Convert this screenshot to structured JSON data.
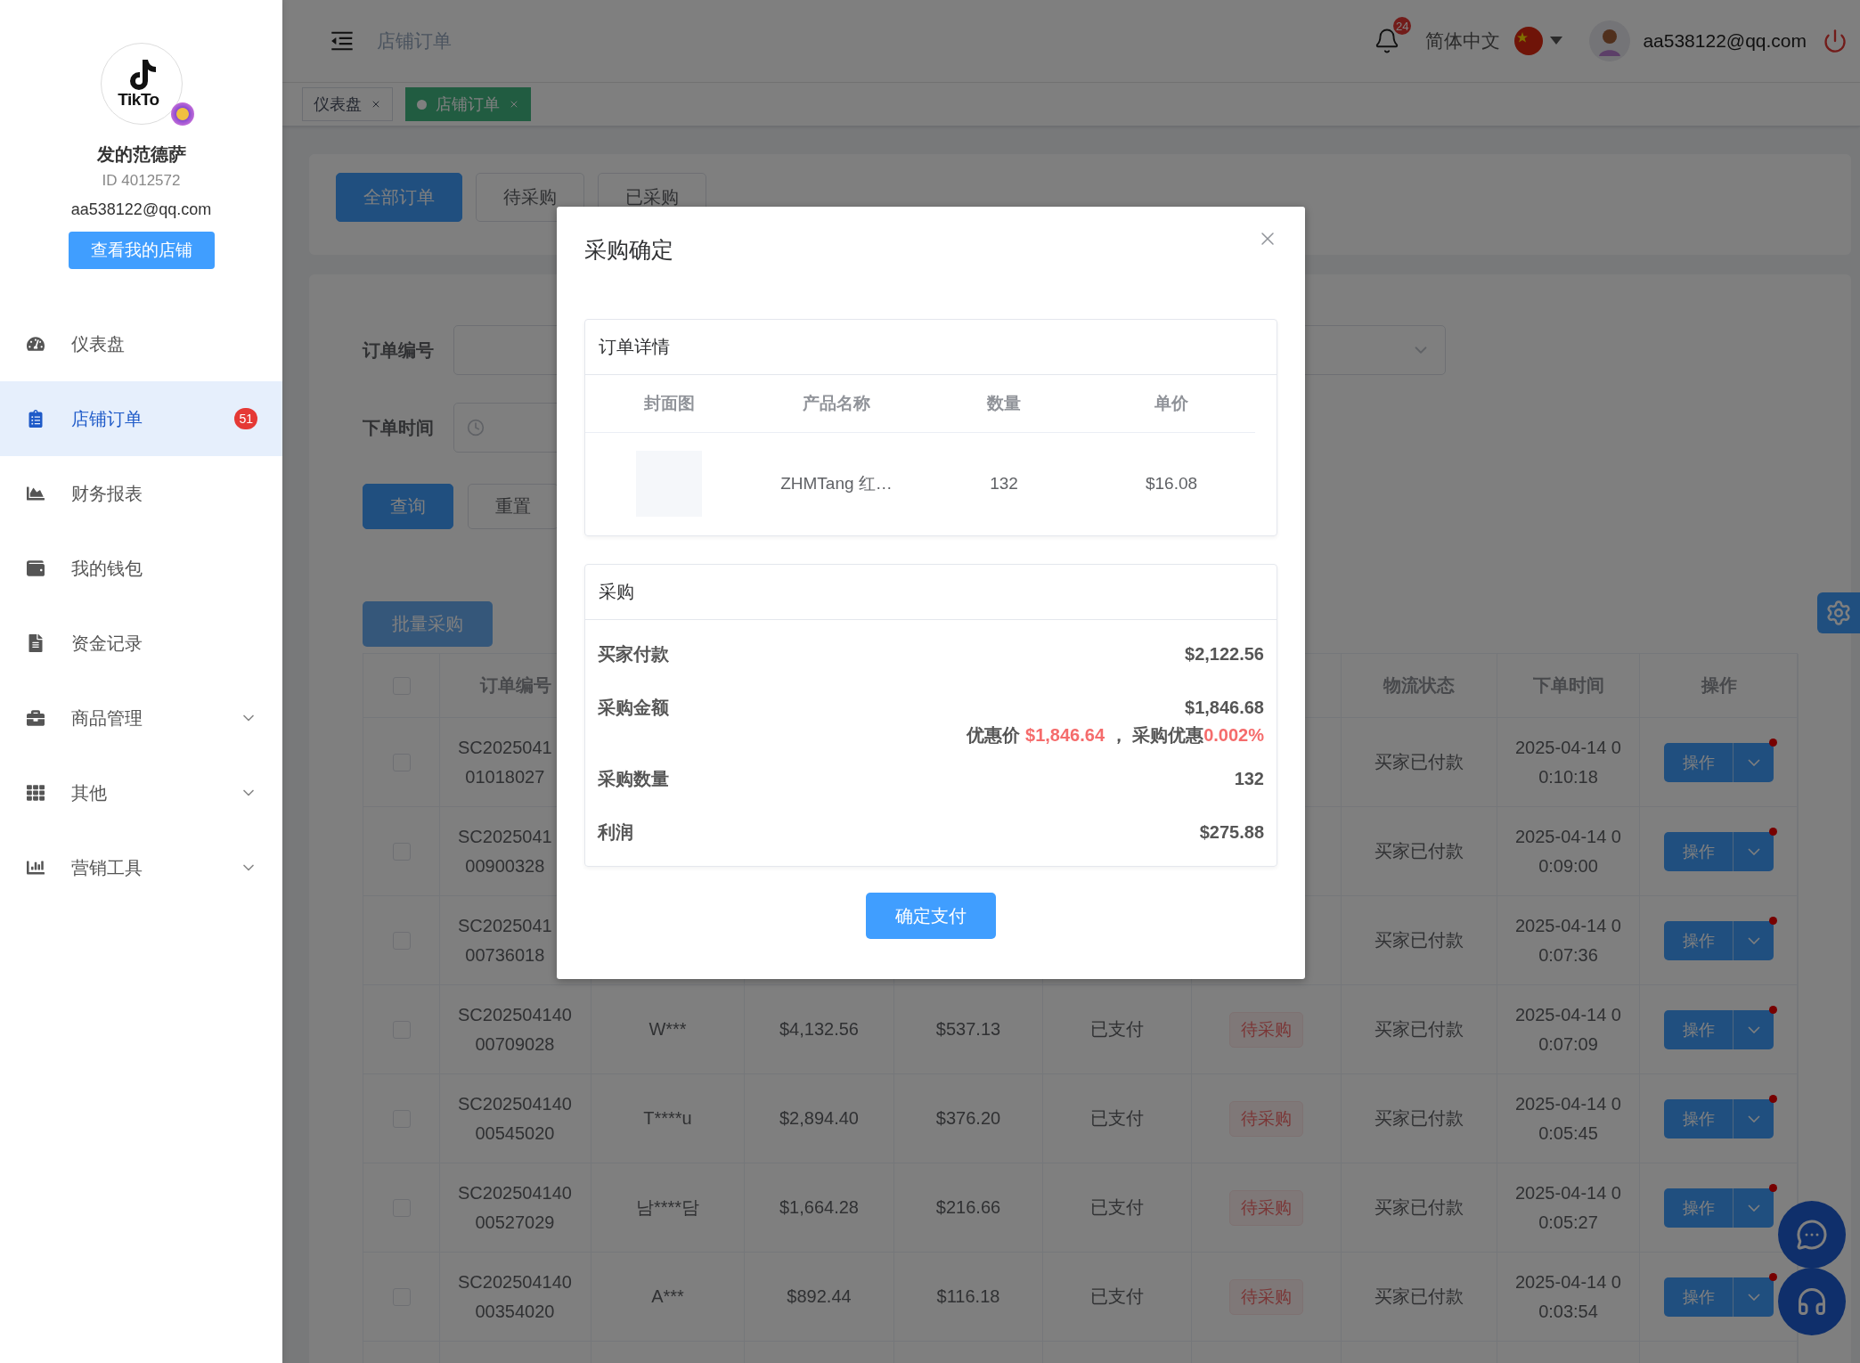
{
  "sidebar": {
    "logo_text": "TikTo",
    "shop_name": "发的范德萨",
    "shop_id": "ID 4012572",
    "email": "aa538122@qq.com",
    "shop_button": "查看我的店铺",
    "items": [
      {
        "label": "仪表盘",
        "selected": false
      },
      {
        "label": "店铺订单",
        "selected": true,
        "badge": "51"
      },
      {
        "label": "财务报表",
        "selected": false
      },
      {
        "label": "我的钱包",
        "selected": false
      },
      {
        "label": "资金记录",
        "selected": false
      },
      {
        "label": "商品管理",
        "selected": false,
        "expanded": false
      },
      {
        "label": "其他",
        "selected": false,
        "expanded": false
      },
      {
        "label": "营销工具",
        "selected": false,
        "expanded": false
      }
    ]
  },
  "header": {
    "title": "店铺订单",
    "notifications": "24",
    "language": "简体中文",
    "email": "aa538122@qq.com"
  },
  "tags": [
    {
      "label": "仪表盘",
      "selected": false
    },
    {
      "label": "店铺订单",
      "selected": true
    }
  ],
  "status_tabs": [
    {
      "label": "全部订单",
      "selected": true
    },
    {
      "label": "待采购",
      "selected": false
    },
    {
      "label": "已采购",
      "selected": false
    }
  ],
  "filters": {
    "order_no_label": "订单编号",
    "order_time_label": "下单时间",
    "search_button": "查询",
    "reset_button": "重置"
  },
  "batch_button": {
    "label": "批量采购",
    "disabled": true
  },
  "table": {
    "all_checked": false,
    "headers": {
      "order_no": "订单编号",
      "logistics": "物流状态",
      "time": "下单时间",
      "action": "操作"
    },
    "rows": [
      {
        "checked": false,
        "order_no": [
          "SC2025041",
          "01018027"
        ],
        "logistics": "买家已付款",
        "time": [
          "2025-04-14 0",
          "0:10:18"
        ],
        "action": "操作"
      },
      {
        "checked": false,
        "order_no": [
          "SC2025041",
          "00900328"
        ],
        "logistics": "买家已付款",
        "time": [
          "2025-04-14 0",
          "0:09:00"
        ],
        "action": "操作"
      },
      {
        "checked": false,
        "order_no": [
          "SC2025041",
          "00736018"
        ],
        "logistics": "买家已付款",
        "time": [
          "2025-04-14 0",
          "0:07:36"
        ],
        "action": "操作"
      },
      {
        "checked": false,
        "order_no": [
          "SC202504140",
          "00709028"
        ],
        "buyer": "W***",
        "amount": "$4,132.56",
        "profit": "$537.13",
        "payment": "已支付",
        "purchase_status": "待采购",
        "logistics": "买家已付款",
        "time": [
          "2025-04-14 0",
          "0:07:09"
        ],
        "action": "操作"
      },
      {
        "checked": false,
        "order_no": [
          "SC202504140",
          "00545020"
        ],
        "buyer": "T****u",
        "amount": "$2,894.40",
        "profit": "$376.20",
        "payment": "已支付",
        "purchase_status": "待采购",
        "logistics": "买家已付款",
        "time": [
          "2025-04-14 0",
          "0:05:45"
        ],
        "action": "操作"
      },
      {
        "checked": false,
        "order_no": [
          "SC202504140",
          "00527029"
        ],
        "buyer": "남****담",
        "amount": "$1,664.28",
        "profit": "$216.66",
        "payment": "已支付",
        "purchase_status": "待采购",
        "logistics": "买家已付款",
        "time": [
          "2025-04-14 0",
          "0:05:27"
        ],
        "action": "操作"
      },
      {
        "checked": false,
        "order_no": [
          "SC202504140",
          "00354020"
        ],
        "buyer": "A***",
        "amount": "$892.44",
        "profit": "$116.18",
        "payment": "已支付",
        "purchase_status": "待采购",
        "logistics": "买家已付款",
        "time": [
          "2025-04-14 0",
          "0:03:54"
        ],
        "action": "操作"
      }
    ]
  },
  "modal": {
    "title": "采购确定",
    "details": {
      "title": "订单详情",
      "columns": [
        "封面图",
        "产品名称",
        "数量",
        "单价"
      ],
      "rows": [
        {
          "product": "ZHMTang 红…",
          "quantity": "132",
          "price": "$16.08"
        }
      ]
    },
    "purchase": {
      "title": "采购",
      "rows": [
        {
          "kind": "value",
          "label": "买家付款",
          "value": "$2,122.56"
        },
        {
          "kind": "value",
          "label": "采购金额",
          "value": "$1,846.68"
        },
        {
          "kind": "discount",
          "price_label": "优惠价",
          "price": "$1,846.64",
          "separator": "，",
          "rate_label": "采购优惠",
          "rate": "0.002%"
        },
        {
          "kind": "value",
          "label": "采购数量",
          "value": "132"
        },
        {
          "kind": "value",
          "label": "利润",
          "value": "$275.88"
        }
      ]
    },
    "confirm_button": "确定支付"
  }
}
